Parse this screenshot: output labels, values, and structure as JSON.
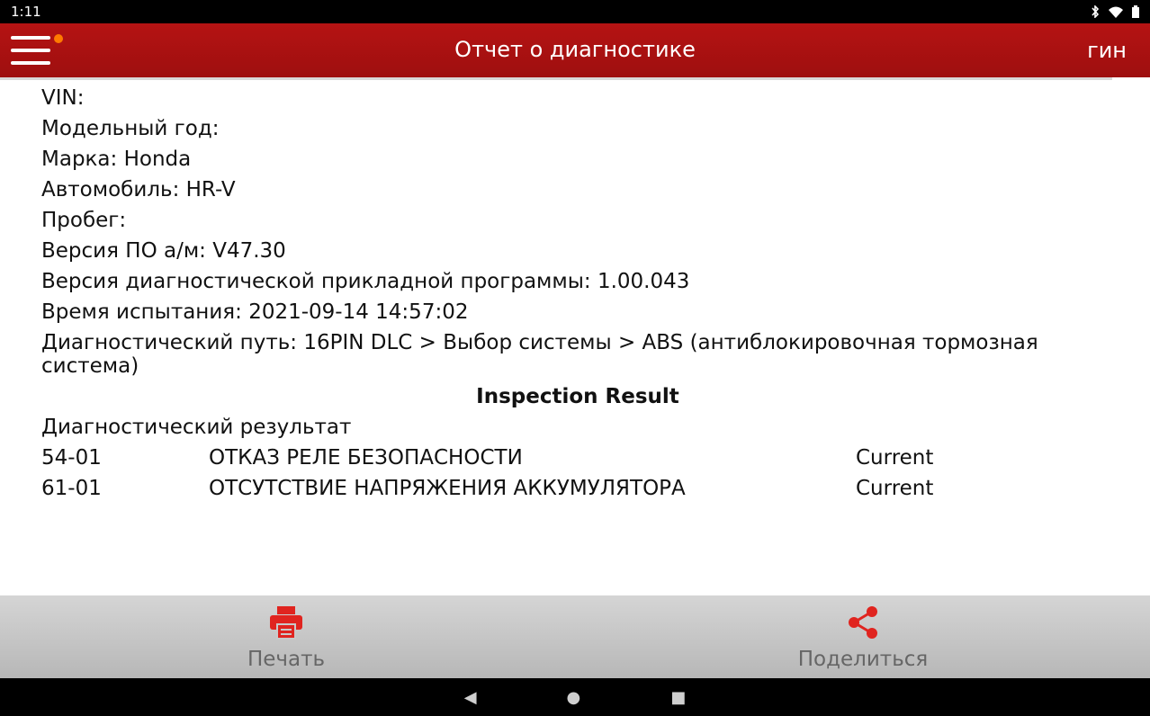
{
  "status_bar": {
    "time": "1:11",
    "icons": [
      "bluetooth-icon",
      "wifi-icon",
      "battery-icon"
    ]
  },
  "app_bar": {
    "title": "Отчет о диагностике",
    "right_text": "гин",
    "menu_badge_color": "#ff7a00"
  },
  "report": {
    "vin": "VIN:",
    "model_year": "Модельный год:",
    "make": "Марка: Honda",
    "vehicle": "Автомобиль: HR-V",
    "mileage": "Пробег:",
    "sw_version": "Версия ПО а/м: V47.30",
    "app_version": "Версия диагностической прикладной программы: 1.00.043",
    "test_time": "Время испытания:  2021-09-14 14:57:02",
    "diag_path": "Диагностический путь: 16PIN DLC > Выбор системы > ABS (антиблокировочная тормозная система)",
    "inspection_title": "Inspection Result",
    "diag_result_label": "Диагностический результат",
    "dtcs": [
      {
        "code": "54-01",
        "description": "ОТКАЗ РЕЛЕ БЕЗОПАСНОСТИ",
        "status": "Current"
      },
      {
        "code": "61-01",
        "description": "ОТСУТСТВИЕ НАПРЯЖЕНИЯ АККУМУЛЯТОРА",
        "status": "Current"
      }
    ]
  },
  "bottom_bar": {
    "print_label": "Печать",
    "share_label": "Поделиться",
    "accent_color": "#e0241f"
  },
  "nav_bar": {
    "back": "◀",
    "home": "●",
    "recents": "■"
  }
}
